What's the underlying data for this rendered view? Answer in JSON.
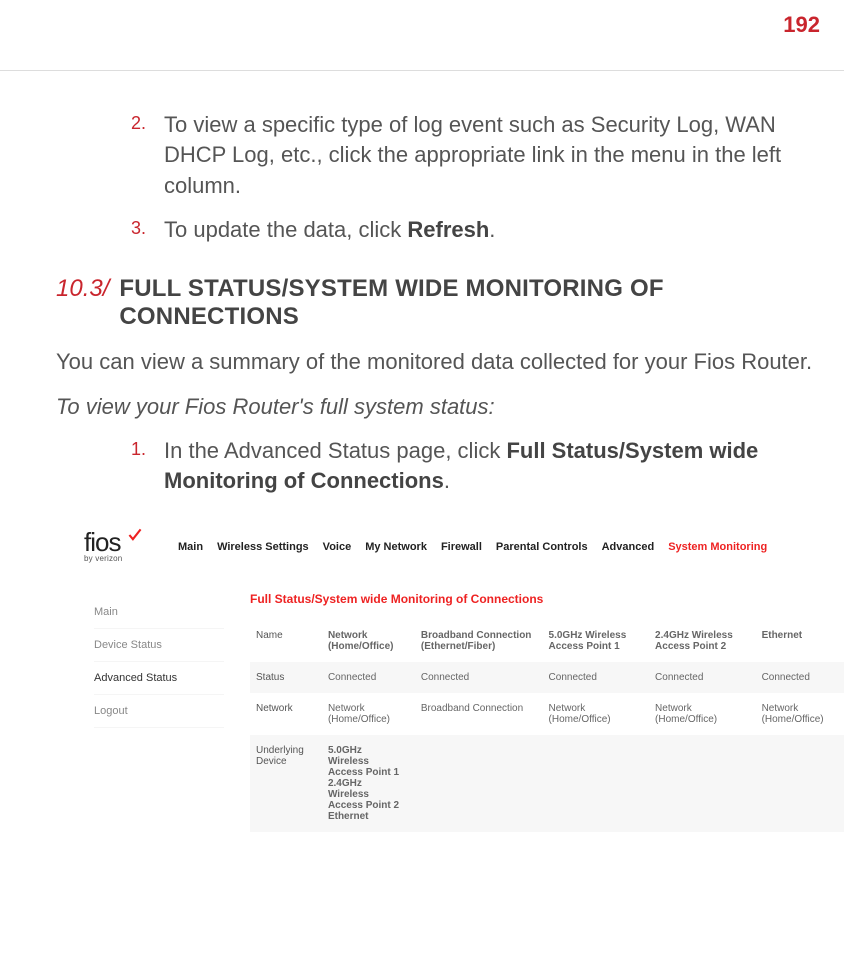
{
  "page_number": "192",
  "steps_upper": [
    {
      "num": "2.",
      "text_pre": "To view a specific type of log event such as Security Log, WAN DHCP Log, etc., click the appropriate link in the menu in the left column.",
      "bold": ""
    },
    {
      "num": "3.",
      "text_pre": "To update the data, click ",
      "bold": "Refresh",
      "text_post": "."
    }
  ],
  "section": {
    "num": "10.3/",
    "title": "FULL STATUS/SYSTEM WIDE MONITORING OF CONNECTIONS"
  },
  "para1": "You can view a summary of the monitored data collected for your Fios Router.",
  "para_italic": "To view your Fios Router's full system status:",
  "steps_lower": [
    {
      "num": "1.",
      "text_pre": "In the Advanced Status page, click ",
      "bold": "Full Status/System wide Monitoring of Connections",
      "text_post": "."
    }
  ],
  "ui": {
    "logo": {
      "fios": "fios",
      "by": "by verizon"
    },
    "nav": [
      "Main",
      "Wireless Settings",
      "Voice",
      "My Network",
      "Firewall",
      "Parental Controls",
      "Advanced",
      "System Monitoring"
    ],
    "nav_active_index": 7,
    "sidebar": [
      "Main",
      "Device Status",
      "Advanced Status",
      "Logout"
    ],
    "sidebar_selected_index": 2,
    "panel_title": "Full Status/System wide Monitoring of Connections",
    "table": {
      "name_row": {
        "label": "Name",
        "vals": [
          "Network (Home/Office)",
          "Broadband Connection (Ethernet/Fiber)",
          "5.0GHz Wireless Access Point 1",
          "2.4GHz Wireless Access Point 2",
          "Ethernet"
        ]
      },
      "status_row": {
        "label": "Status",
        "vals": [
          "Connected",
          "Connected",
          "Connected",
          "Connected",
          "Connected"
        ]
      },
      "network_row": {
        "label": "Network",
        "vals": [
          "Network (Home/Office)",
          "Broadband Connection",
          "Network (Home/Office)",
          "Network (Home/Office)",
          "Network (Home/Office)"
        ]
      },
      "underlying_row": {
        "label": "Underlying Device",
        "val": "5.0GHz\nWireless\nAccess Point 1\n2.4GHz\nWireless\nAccess Point 2\nEthernet"
      }
    }
  }
}
